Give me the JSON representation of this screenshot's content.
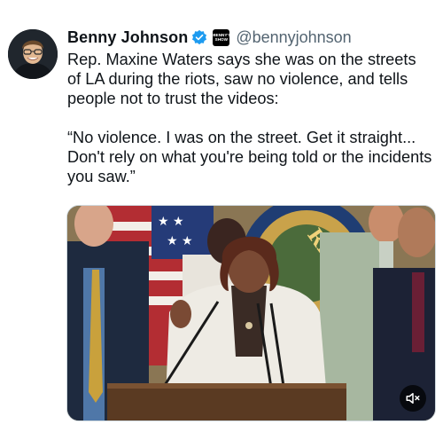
{
  "author": {
    "name": "Benny Johnson",
    "handle": "@bennyjohnson",
    "verified_icon": "verified-badge-icon",
    "affiliate_badge_lines": [
      "BENNY'S",
      "SHOW"
    ],
    "colors": {
      "verified": "#1d9bf0",
      "handle": "#536471"
    }
  },
  "post": {
    "paragraphs": [
      "Rep. Maxine Waters says she was on the streets of LA during the riots, saw no violence, and tells people not to trust the videos:",
      "“No violence. I was on the street. Get it straight... Don't rely on what you're being told or the incidents you saw.”"
    ]
  },
  "media": {
    "type": "video",
    "mute_icon": "speaker-muted-icon",
    "seal_text": "REPR"
  }
}
